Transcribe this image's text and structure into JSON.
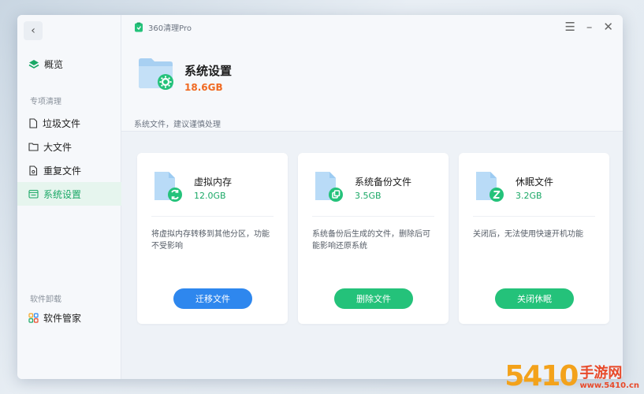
{
  "app": {
    "title": "360清理Pro"
  },
  "sidebar": {
    "overview_label": "概览",
    "section_special": "专项清理",
    "items": [
      {
        "label": "垃圾文件",
        "active": false
      },
      {
        "label": "大文件",
        "active": false
      },
      {
        "label": "重复文件",
        "active": false
      },
      {
        "label": "系统设置",
        "active": true
      }
    ],
    "section_uninstall": "软件卸载",
    "software_label": "软件管家"
  },
  "header": {
    "title": "系统设置",
    "size": "18.6GB",
    "note": "系统文件，建议谨慎处理"
  },
  "cards": [
    {
      "title": "虚拟内存",
      "size": "12.0GB",
      "desc": "将虚拟内存转移到其他分区，功能不受影响",
      "button": "迁移文件"
    },
    {
      "title": "系统备份文件",
      "size": "3.5GB",
      "desc": "系统备份后生成的文件，删除后可能影响还原系统",
      "button": "删除文件"
    },
    {
      "title": "休眠文件",
      "size": "3.2GB",
      "desc": "关闭后，无法使用快速开机功能",
      "button": "关闭休眠"
    }
  ],
  "colors": {
    "accent_green": "#1aa866",
    "button_blue": "#2e87ee",
    "button_green": "#24c27a",
    "size_orange": "#f06a22"
  },
  "watermark": {
    "number": "5410",
    "text": "手游网",
    "url": "www.5410.cn"
  }
}
